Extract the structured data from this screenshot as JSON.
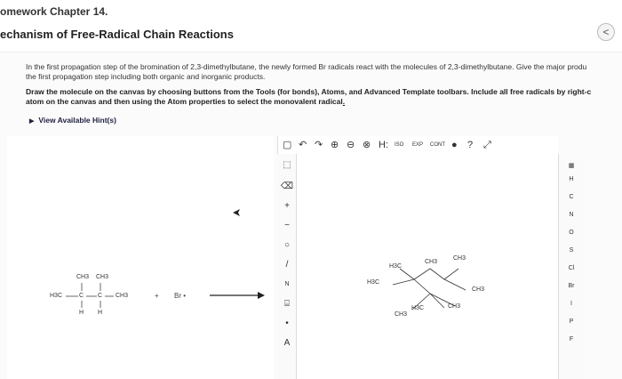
{
  "header": {
    "assignment_title": "omework Chapter 14.",
    "section_title": "echanism of Free-Radical Chain Reactions",
    "back_button_glyph": "<"
  },
  "question": {
    "text_line1": "In the first propagation step of the bromination of 2,3-dimethylbutane, the newly formed Br radicals react with the molecules of 2,3-dimethylbutane. Give the major produ",
    "text_line2": "the first propagation step including both organic and inorganic products."
  },
  "instruction": {
    "line1": "Draw the molecule on the canvas by choosing buttons from the Tools (for bonds), Atoms, and Advanced Template toolbars. Include all free radicals by right-c",
    "line2_before": "atom on the canvas and then using the Atom properties to select the monovalent radical",
    "line2_underlined": ".",
    "accent_color": "#1a1a1a"
  },
  "hints": {
    "label": "View Available Hint(s)"
  },
  "reaction": {
    "reagent_label": "Br •",
    "plus_sign": "+",
    "labels": {
      "ch3_a": "CH3",
      "ch3_b": "CH3",
      "h3c": "H3C",
      "c1": "C",
      "c2": "C",
      "ch3_c": "CH3",
      "h1": "H",
      "h2": "H"
    }
  },
  "editor": {
    "top_toolbar": [
      "new-doc-icon",
      "undo-icon",
      "redo-icon",
      "zoom-in-icon",
      "zoom-out-icon",
      "clear-icon",
      "H:",
      "iso-icon",
      "exp-icon",
      "cont-icon",
      "info-icon",
      "help-icon",
      "expand-icon"
    ],
    "top_text": {
      "h_label": "H:",
      "iso_label": "ISO",
      "exp_label": "EXP",
      "cont_label": "CONT"
    },
    "left_tools": {
      "selection_glyph": "⬚",
      "eraser_glyph": "⌫",
      "plus_charge": "+",
      "minus_charge": "−",
      "ring_glyph": "○",
      "bond_glyph": "/",
      "n_label": "N",
      "template_glyph": "⌸",
      "radical_glyph": "•",
      "atom_a_label": "A"
    },
    "atoms": [
      "H",
      "C",
      "N",
      "O",
      "S",
      "Cl",
      "Br",
      "I",
      "P",
      "F"
    ],
    "molecule_labels": {
      "h3c_top": "H3C",
      "ch3_top": "CH3",
      "ch3_topright": "CH3",
      "h3c_left": "H3C",
      "ch3_right": "CH3",
      "ch3_bottom": "CH3",
      "h3c_bottom": "H3C",
      "ch3_bottomright": "CH3"
    }
  }
}
